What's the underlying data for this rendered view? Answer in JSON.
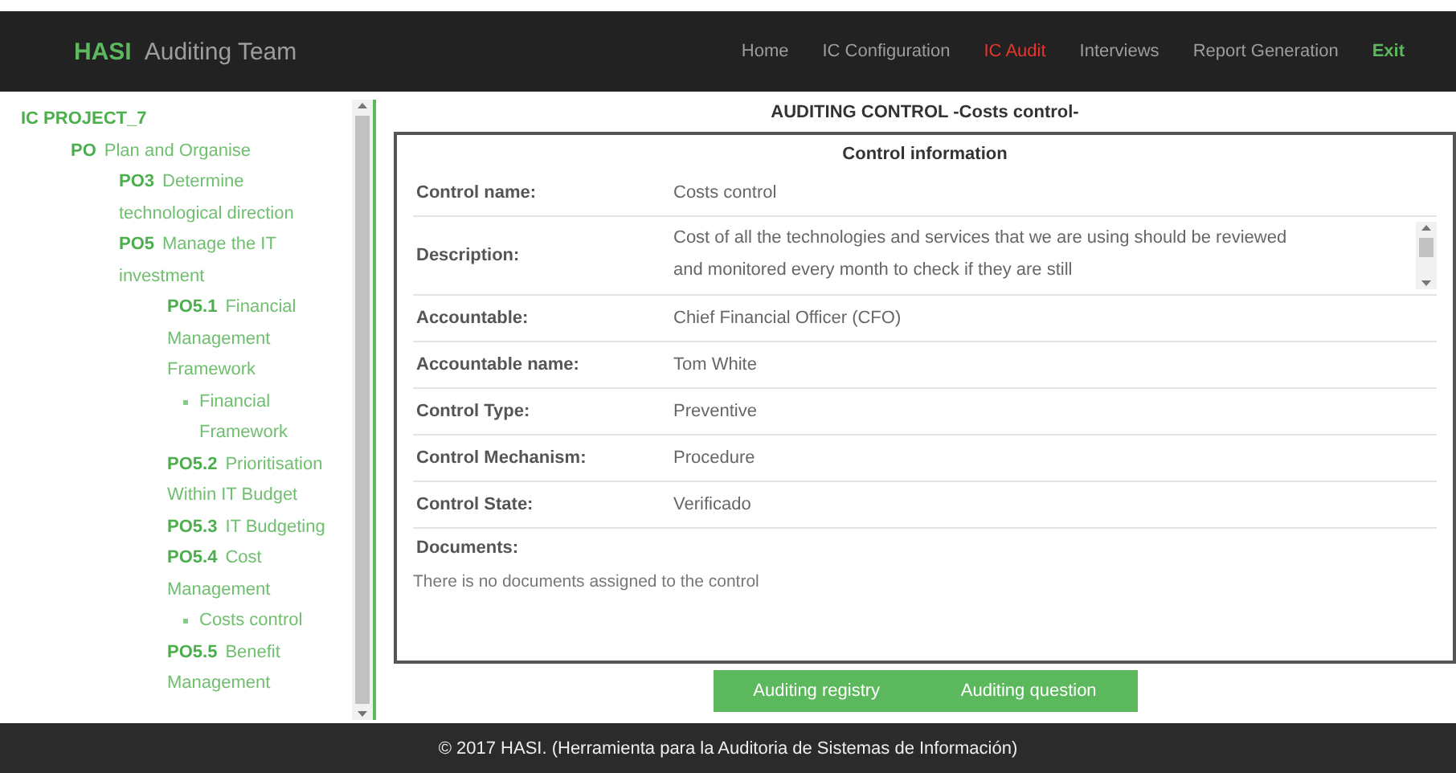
{
  "navbar": {
    "brand": "HASI",
    "subtitle": "Auditing Team",
    "items": [
      {
        "label": "Home",
        "kind": "link",
        "selected": false
      },
      {
        "label": "IC Configuration",
        "kind": "link",
        "selected": false
      },
      {
        "label": "IC Audit",
        "kind": "link",
        "selected": true
      },
      {
        "label": "Interviews",
        "kind": "link",
        "selected": false
      },
      {
        "label": "Report Generation",
        "kind": "link",
        "selected": false
      },
      {
        "label": "Exit",
        "kind": "exit",
        "selected": false
      }
    ]
  },
  "tree": {
    "title": "IC PROJECT_7",
    "children": [
      {
        "code": "PO",
        "label": "Plan and Organise",
        "children": [
          {
            "code": "PO3",
            "label": "Determine technological direction"
          },
          {
            "code": "PO5",
            "label": "Manage the IT investment",
            "children": [
              {
                "code": "PO5.1",
                "label": "Financial Management Framework",
                "children": [
                  {
                    "kind": "control",
                    "label": "Financial Framework"
                  }
                ]
              },
              {
                "code": "PO5.2",
                "label": "Prioritisation Within IT Budget"
              },
              {
                "code": "PO5.3",
                "label": "IT Budgeting"
              },
              {
                "code": "PO5.4",
                "label": "Cost Management",
                "children": [
                  {
                    "kind": "control",
                    "label": "Costs control"
                  }
                ]
              },
              {
                "code": "PO5.5",
                "label": "Benefit Management"
              }
            ]
          }
        ]
      }
    ]
  },
  "page_title": "AUDITING CONTROL -Costs control-",
  "panel": {
    "title": "Control information",
    "fields": [
      {
        "label": "Control name:",
        "kind": "text",
        "value": "Costs control"
      },
      {
        "label": "Description:",
        "kind": "scroll",
        "value": "Cost of all the technologies and services that we are using should be reviewed and monitored every month to check if they are still"
      },
      {
        "label": "Accountable:",
        "kind": "text",
        "value": "Chief Financial Officer (CFO)"
      },
      {
        "label": "Accountable name:",
        "kind": "text",
        "value": "Tom White"
      },
      {
        "label": "Control Type:",
        "kind": "text",
        "value": "Preventive"
      },
      {
        "label": "Control Mechanism:",
        "kind": "text",
        "value": "Procedure"
      },
      {
        "label": "Control State:",
        "kind": "text",
        "value": "Verificado"
      }
    ],
    "documents_label": "Documents:",
    "documents_empty": "There is no documents assigned to the control"
  },
  "buttons": [
    "Auditing registry",
    "Auditing question"
  ],
  "footer": "© 2017 HASI. (Herramienta para la Auditoria de Sistemas de Información)"
}
